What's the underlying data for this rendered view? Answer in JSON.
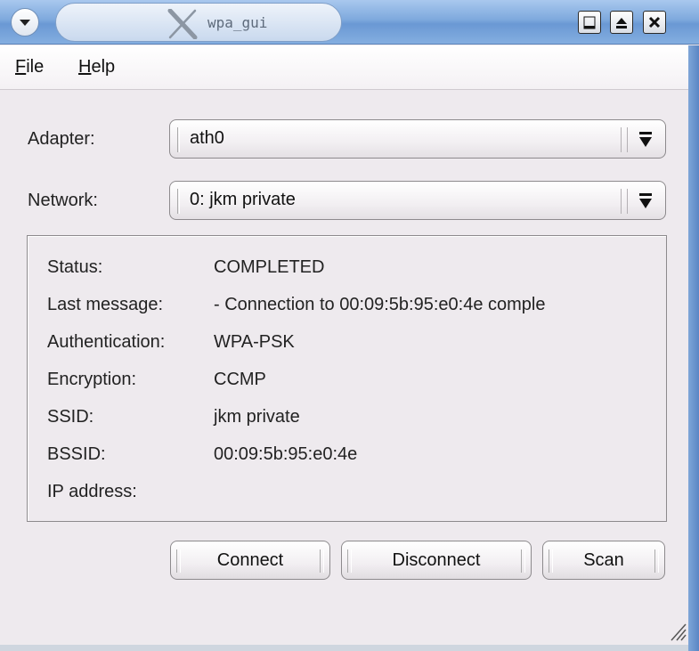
{
  "window": {
    "title": "wpa_gui"
  },
  "menu": {
    "file": {
      "accel": "F",
      "rest": "ile"
    },
    "help": {
      "accel": "H",
      "rest": "elp"
    }
  },
  "form": {
    "adapter_label": "Adapter:",
    "adapter_value": "ath0",
    "network_label": "Network:",
    "network_value": "0: jkm private"
  },
  "status": {
    "rows": [
      {
        "label": "Status:",
        "value": "COMPLETED"
      },
      {
        "label": "Last message:",
        "value": "- Connection to 00:09:5b:95:e0:4e comple"
      },
      {
        "label": "Authentication:",
        "value": "WPA-PSK"
      },
      {
        "label": "Encryption:",
        "value": "CCMP"
      },
      {
        "label": "SSID:",
        "value": "jkm private"
      },
      {
        "label": "BSSID:",
        "value": "00:09:5b:95:e0:4e"
      },
      {
        "label": "IP address:",
        "value": ""
      }
    ]
  },
  "buttons": {
    "connect": "Connect",
    "disconnect": "Disconnect",
    "scan": "Scan"
  }
}
